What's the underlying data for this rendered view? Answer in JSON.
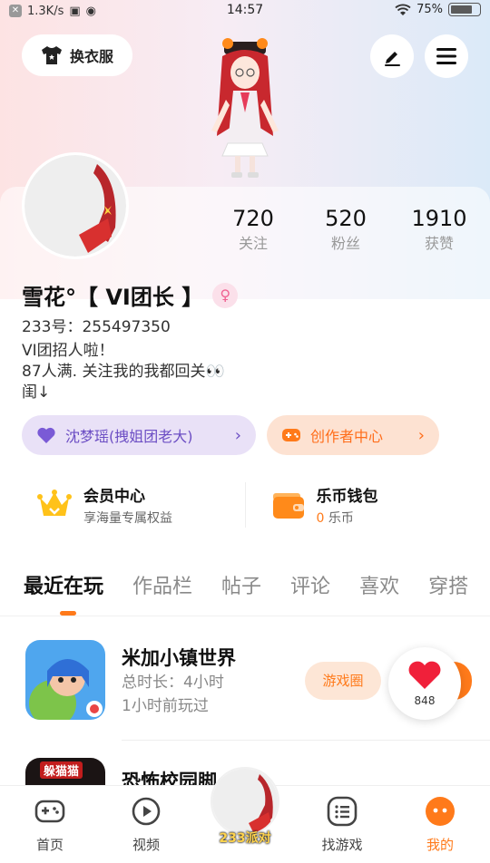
{
  "status_bar": {
    "speed": "1.3K/s",
    "time": "14:57",
    "battery": "75%",
    "battery_level": 0.75
  },
  "header": {
    "outfit_label": "换衣服"
  },
  "profile": {
    "stats": [
      {
        "num": "720",
        "label": "关注"
      },
      {
        "num": "520",
        "label": "粉丝"
      },
      {
        "num": "1910",
        "label": "获赞"
      }
    ],
    "name": "雪花°【 VI团长 】",
    "gender_symbol": "♀",
    "account_id": "233号：255497350",
    "bio_lines": [
      "VI团招人啦！",
      "87人满. 关注我的我都回关👀",
      "闺↓"
    ],
    "group_pill": "沈梦瑶(拽姐团老大)",
    "creator_pill": "创作者中心",
    "arrow": "›"
  },
  "wallet": {
    "member_title": "会员中心",
    "member_sub": "享海量专属权益",
    "coin_title": "乐币钱包",
    "coin_amount": "0",
    "coin_unit": " 乐币"
  },
  "tabs": [
    "最近在玩",
    "作品栏",
    "帖子",
    "评论",
    "喜欢",
    "穿搭"
  ],
  "games": [
    {
      "title": "米加小镇世界",
      "duration": "总时长：4小时",
      "last_played": "1小时前玩过",
      "button": "游戏圈"
    },
    {
      "title": "恐怖校园脚",
      "icon_text": "躲猫猫"
    }
  ],
  "like_float": {
    "count": "848"
  },
  "bottom_nav": {
    "home": "首页",
    "video": "视频",
    "party": "233派对",
    "find": "找游戏",
    "mine": "我的"
  },
  "colors": {
    "accent": "#ff7a1a",
    "purple": "#6c4ec4"
  }
}
